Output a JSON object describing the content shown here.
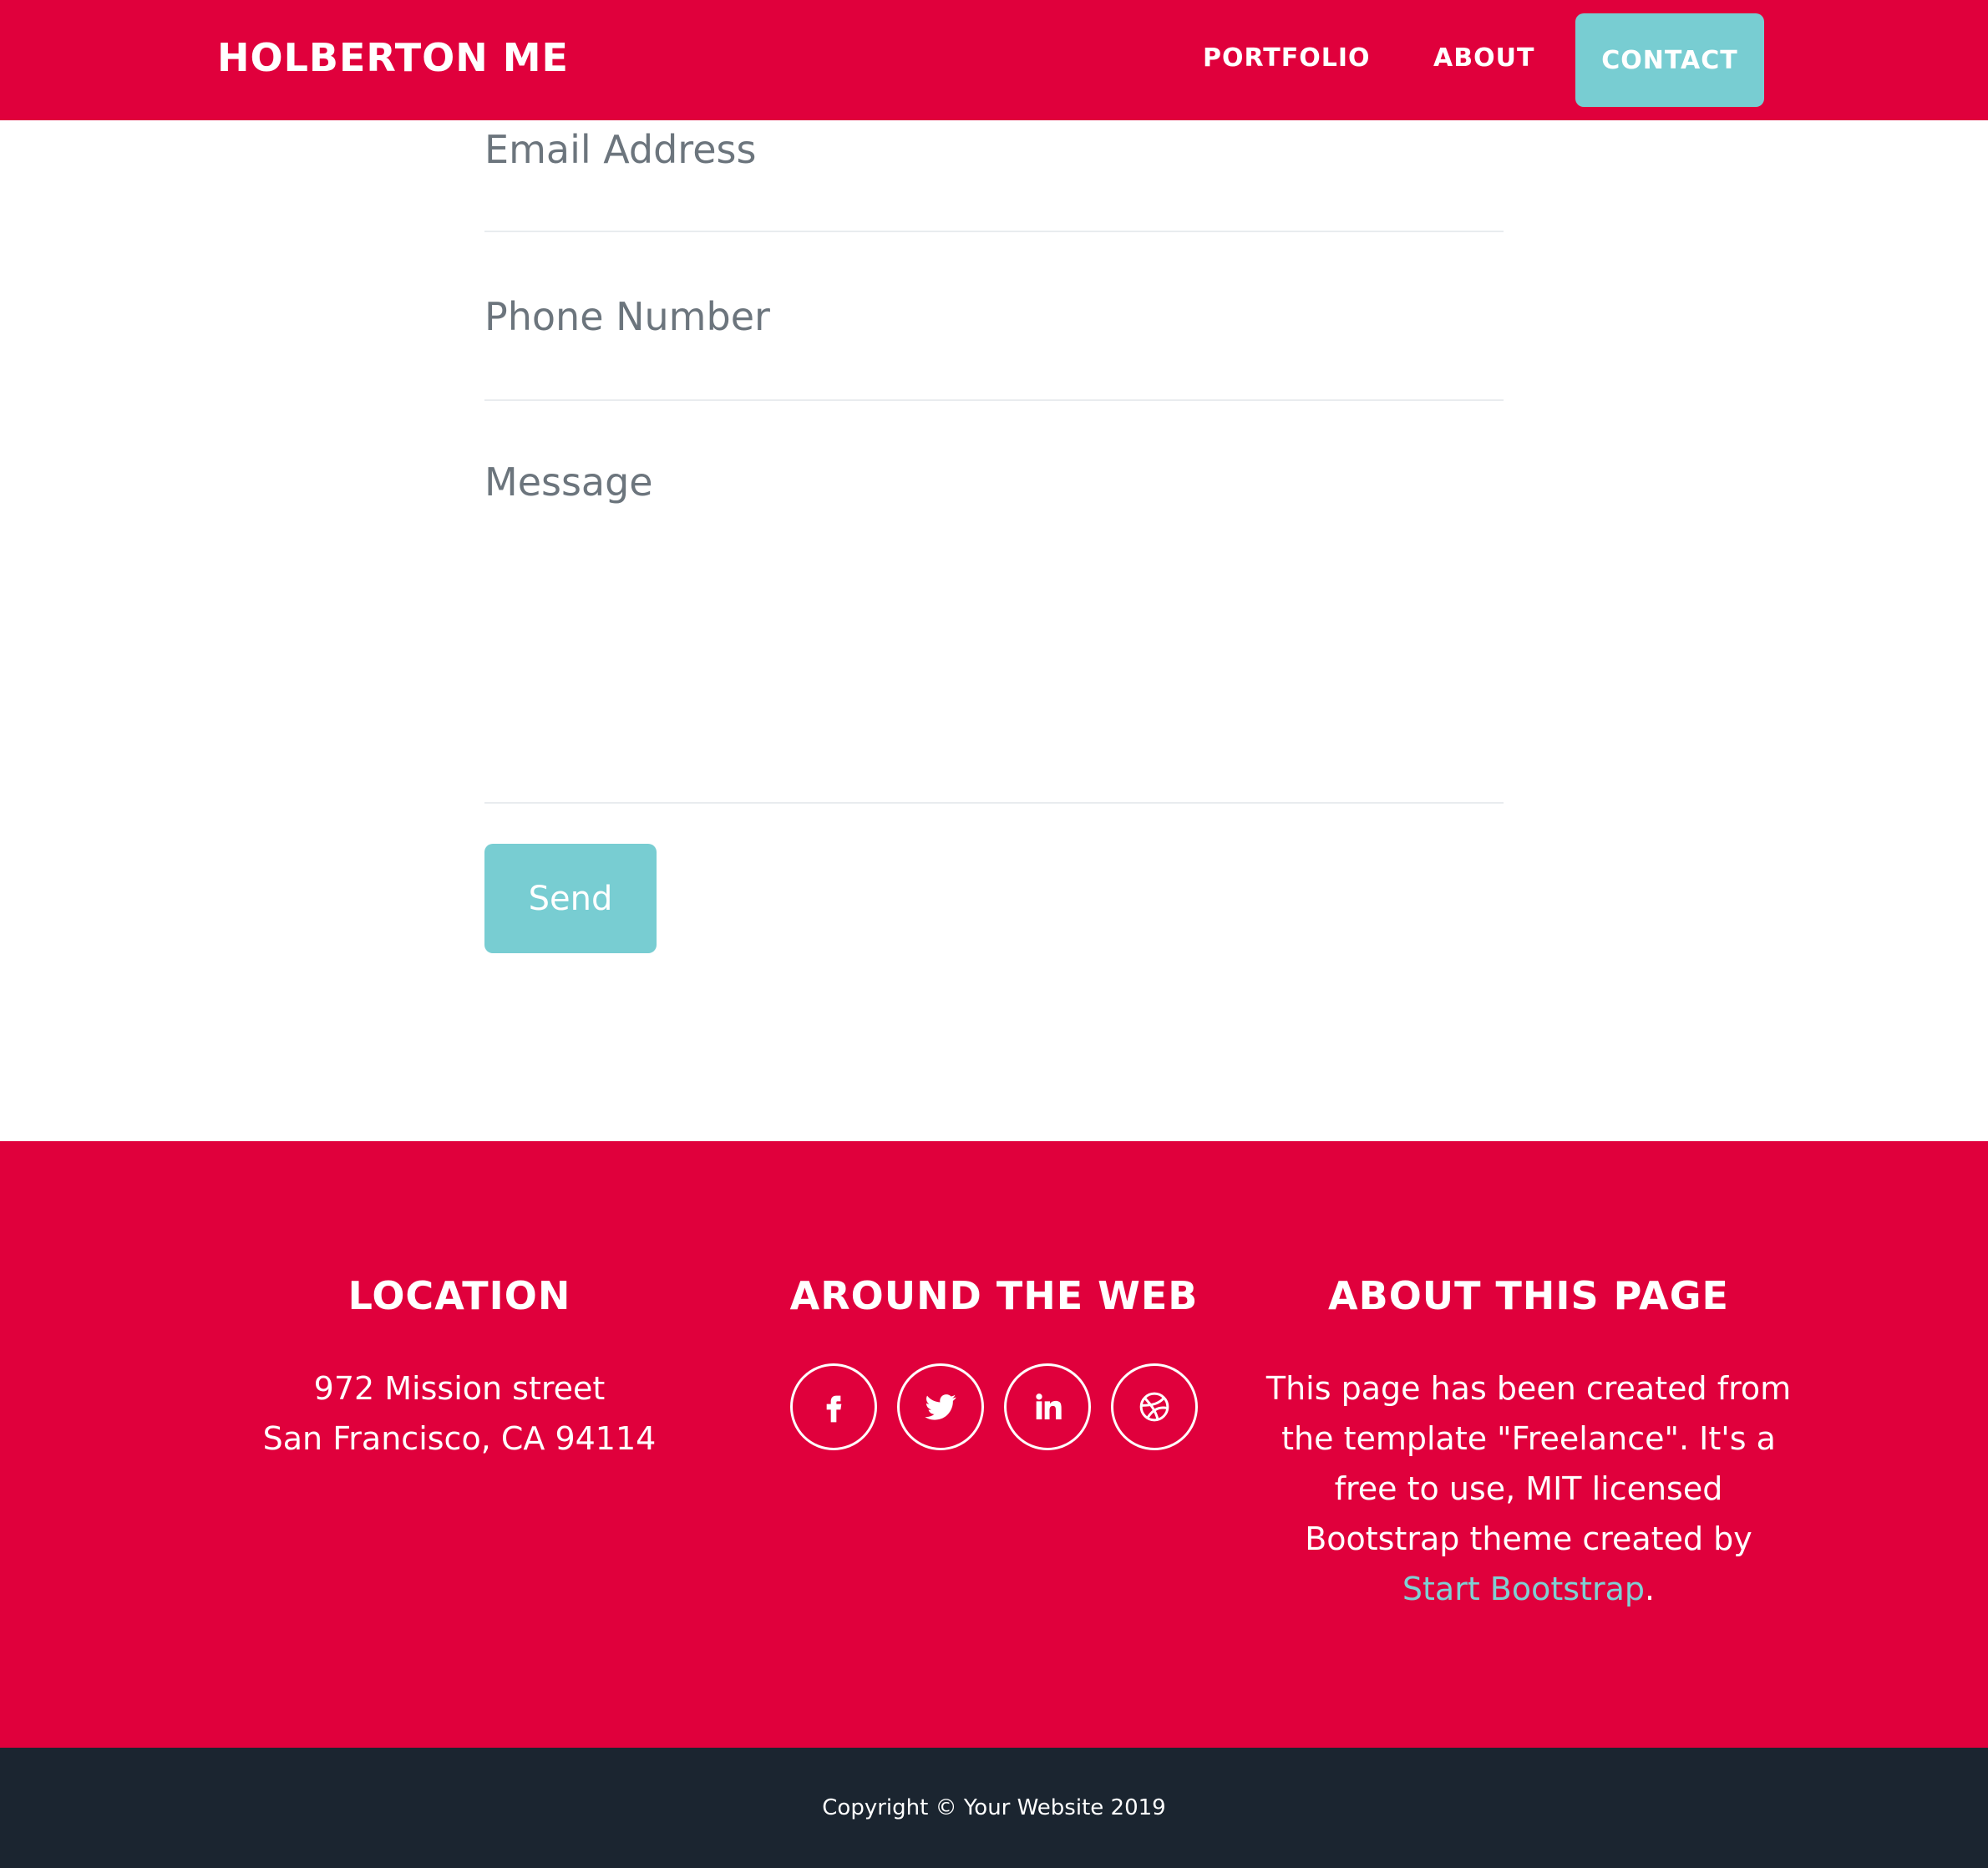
{
  "nav": {
    "brand": "HOLBERTON ME",
    "items": [
      {
        "label": "PORTFOLIO"
      },
      {
        "label": "ABOUT"
      },
      {
        "label": "CONTACT"
      }
    ]
  },
  "form": {
    "email_placeholder": "Email Address",
    "phone_placeholder": "Phone Number",
    "message_placeholder": "Message",
    "send_label": "Send"
  },
  "footer": {
    "location": {
      "title": "LOCATION",
      "line1": "972 Mission street",
      "line2": "San Francisco, CA 94114"
    },
    "web": {
      "title": "AROUND THE WEB",
      "icons": [
        "facebook-icon",
        "twitter-icon",
        "linkedin-icon",
        "dribbble-icon"
      ]
    },
    "about": {
      "title": "ABOUT THIS PAGE",
      "text": "This page has been created from the template \"Freelance\". It's a free to use, MIT licensed Bootstrap theme created by",
      "link": "Start Bootstrap",
      "period": "."
    }
  },
  "copyright": "Copyright © Your Website 2019",
  "colors": {
    "primary": "#e0003c",
    "accent": "#78cdd2",
    "dark": "#1b2530"
  }
}
